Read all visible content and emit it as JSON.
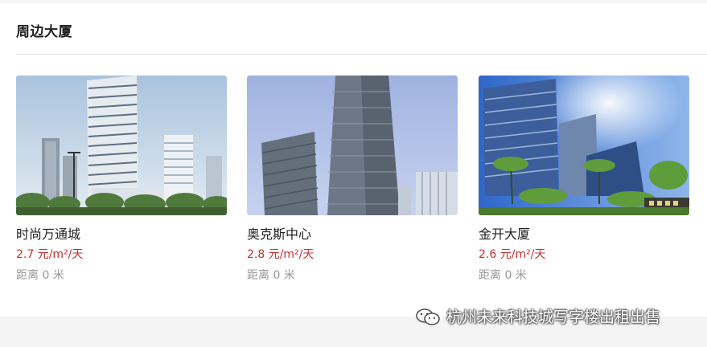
{
  "section": {
    "title": "周边大厦"
  },
  "buildings": [
    {
      "name": "时尚万通城",
      "price": "2.7 元/m²/天",
      "distance": "距离 0 米",
      "image": "fashion-tower-photo"
    },
    {
      "name": "奥克斯中心",
      "price": "2.8 元/m²/天",
      "distance": "距离 0 米",
      "image": "aux-center-photo"
    },
    {
      "name": "金开大厦",
      "price": "2.6 元/m²/天",
      "distance": "距离 0 米",
      "image": "jinkai-building-photo"
    }
  ],
  "watermark": {
    "text": "杭州未来科技城写字楼出租出售",
    "icon": "wechat-icon"
  },
  "colors": {
    "price": "#c9302c",
    "muted": "#999999",
    "title": "#222222"
  }
}
